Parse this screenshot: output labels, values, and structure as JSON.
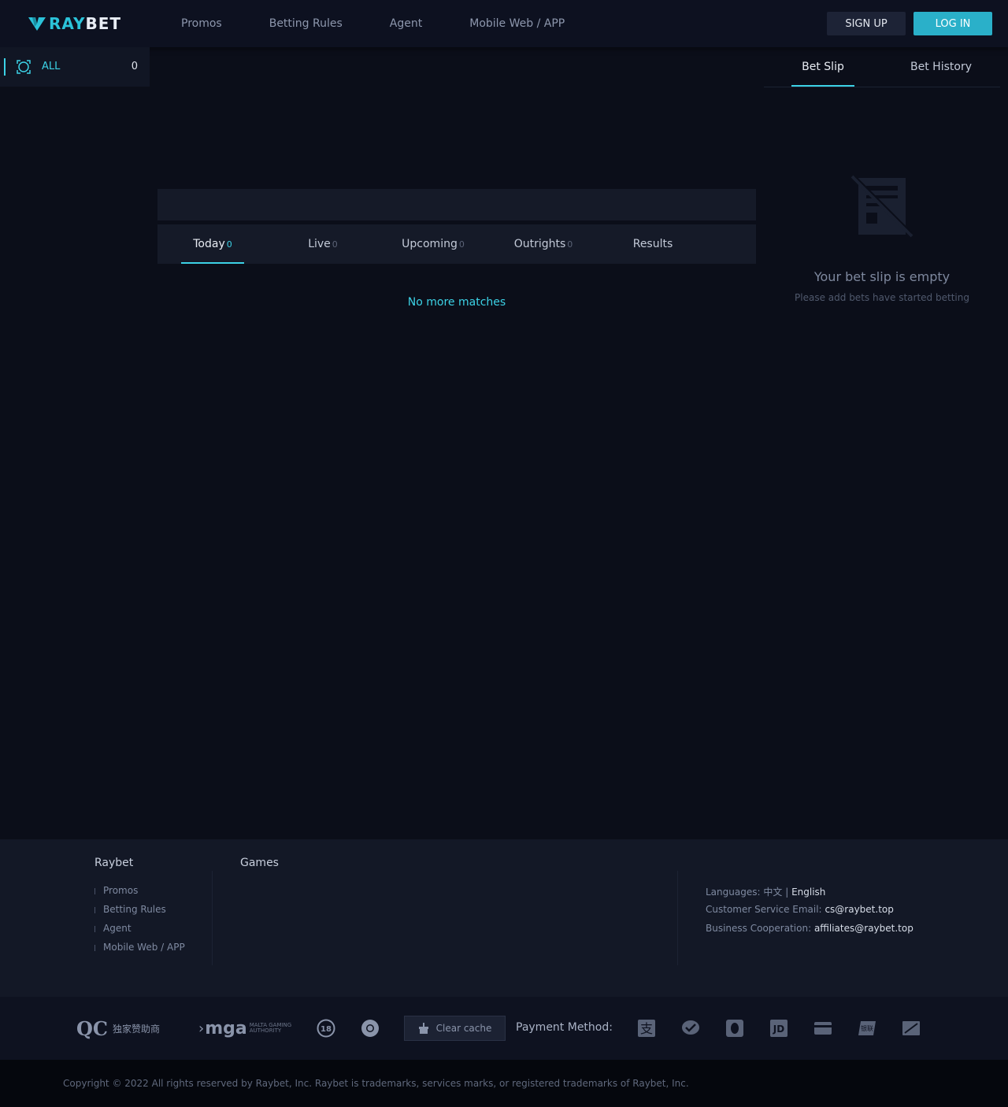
{
  "brand": {
    "logo_prefix": "RAY",
    "logo_suffix": "BET",
    "accent": "#3cd2e6"
  },
  "nav": {
    "items": [
      "Promos",
      "Betting Rules",
      "Agent",
      "Mobile Web / APP"
    ]
  },
  "auth": {
    "signup": "SIGN UP",
    "login": "LOG IN"
  },
  "sidebar": {
    "all_label": "ALL",
    "all_count": "0",
    "icon": "esports-target-icon"
  },
  "match_tabs": [
    {
      "label": "Today",
      "count": "0"
    },
    {
      "label": "Live",
      "count": "0"
    },
    {
      "label": "Upcoming",
      "count": "0"
    },
    {
      "label": "Outrights",
      "count": "0"
    },
    {
      "label": "Results",
      "count": ""
    }
  ],
  "main": {
    "no_more": "No more matches"
  },
  "betslip": {
    "tabs": [
      "Bet Slip",
      "Bet History"
    ],
    "empty_title": "Your bet slip is empty",
    "empty_sub": "Please add bets have started betting"
  },
  "footer": {
    "col1_title": "Raybet",
    "col1_links": [
      "Promos",
      "Betting Rules",
      "Agent",
      "Mobile Web / APP"
    ],
    "col2_title": "Games",
    "languages_label": "Languages:",
    "language_zh": "中文",
    "language_sep": "|",
    "language_en": "English",
    "email_label": "Customer Service Email:",
    "email_value": "cs@raybet.top",
    "biz_label": "Business Cooperation:",
    "biz_value": "affiliates@raybet.top"
  },
  "partners": {
    "qc_logo": "QC",
    "qc_text": "独家赞助商",
    "mga_logo": "mga",
    "mga_sub1": "MALTA GAMING",
    "mga_sub2": "AUTHORITY",
    "age_badge": "18",
    "clear_cache": "Clear cache",
    "payment_label": "Payment Method:",
    "payment_icons": [
      "alipay-icon",
      "wechat-pay-icon",
      "qq-pay-icon",
      "jd-pay-icon",
      "bank-card-icon",
      "unionpay-icon",
      "cloud-flash-pay-icon"
    ]
  },
  "copyright": "Copyright © 2022 All rights reserved by Raybet, Inc. Raybet is trademarks, services marks, or registered trademarks of Raybet, Inc."
}
